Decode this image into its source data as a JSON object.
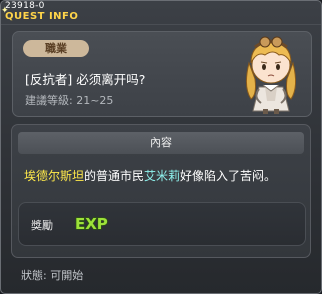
{
  "header": {
    "quest_id": "23918-0",
    "title": "QUEST INFO"
  },
  "quest": {
    "job_badge": "職業",
    "title": "[反抗者] 必须离开吗?",
    "recommended_level": "建議等級: 21~25"
  },
  "content": {
    "section_label": "內容",
    "description_part1": "埃德尔斯坦",
    "description_part2": "的普通市民",
    "description_part3": "艾米莉",
    "description_part4": "好像陷入了苦闷。"
  },
  "reward": {
    "label": "獎勵",
    "exp_text": "EXP"
  },
  "status": {
    "text": "狀態: 可開始"
  }
}
